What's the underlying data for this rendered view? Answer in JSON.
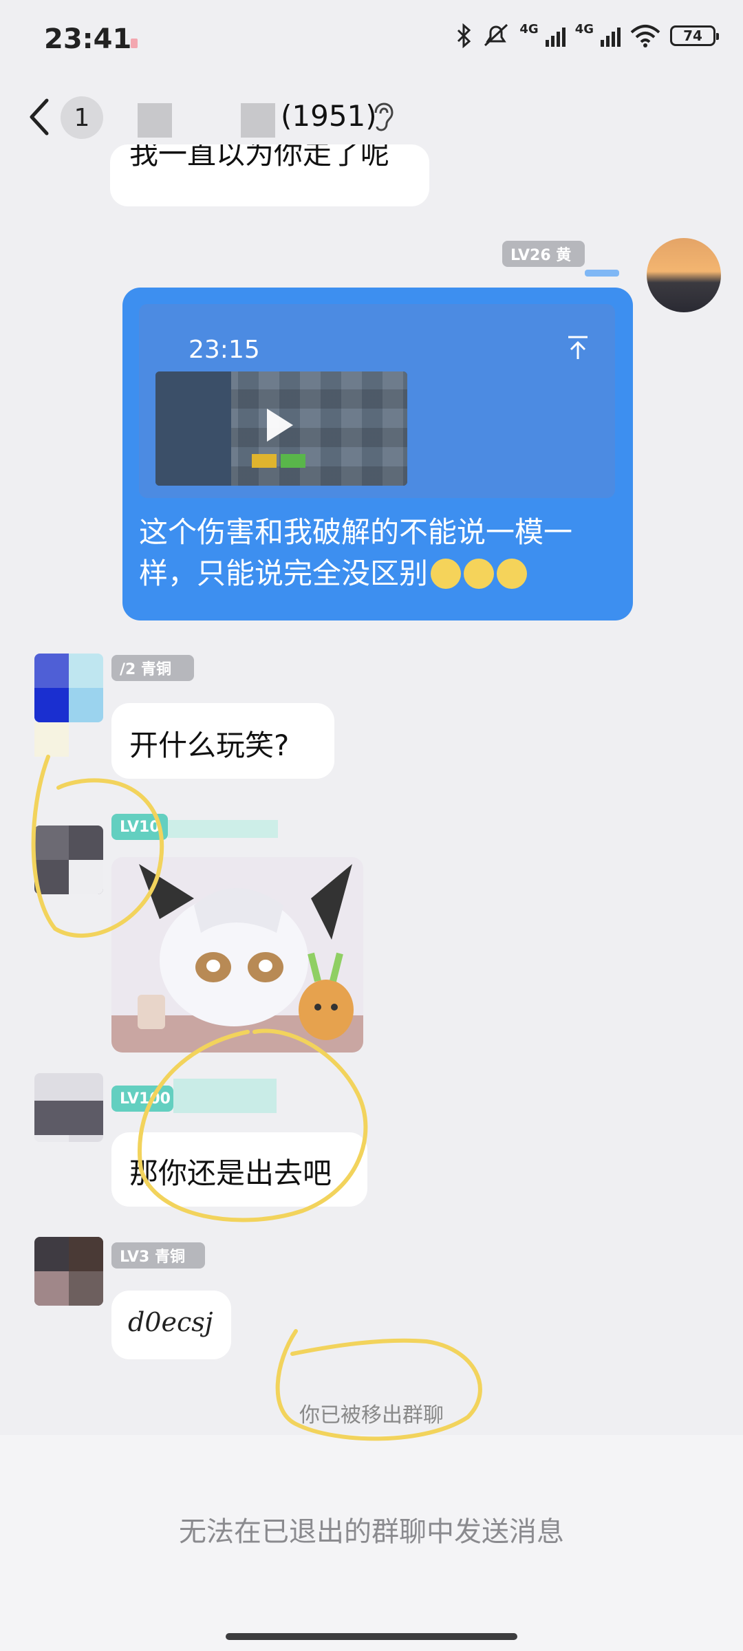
{
  "status_bar": {
    "time": "23:41",
    "network_label_1": "4G",
    "network_label_2": "4G",
    "battery": "74"
  },
  "header": {
    "unread_count": "1",
    "member_count": "(1951)"
  },
  "messages": {
    "top_bubble": "我一直以为你走了呢",
    "self": {
      "level_badge": "LV26 黄",
      "card_time": "23:15",
      "text": "这个伤害和我破解的不能说一模一样，只能说完全没区别"
    },
    "m1": {
      "level_badge": "/2 青铜",
      "text": "开什么玩笑?"
    },
    "m2": {
      "level_badge": "LV10"
    },
    "m3": {
      "level_badge": "LV100",
      "text": "那你还是出去吧"
    },
    "m4": {
      "level_badge": "LV3 青铜",
      "text": "d0ecsj"
    }
  },
  "system_notice": "你已被移出群聊",
  "footer": {
    "notice": "无法在已退出的群聊中发送消息"
  },
  "colors": {
    "self_bubble": "#3d8ff0",
    "highlight": "#f2d35c",
    "teal_badge": "#63cfc0"
  }
}
